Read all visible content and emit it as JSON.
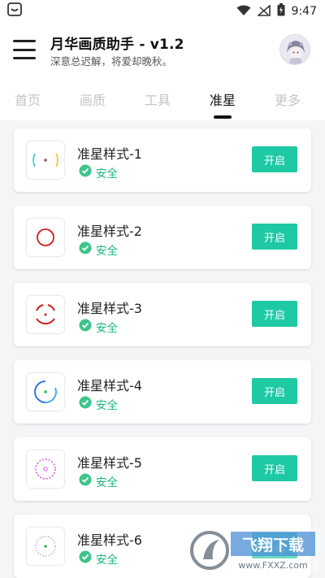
{
  "status_bar": {
    "time": "9:47",
    "icons": [
      "app-notification-icon",
      "wifi-icon",
      "signal-icon",
      "battery-icon"
    ]
  },
  "header": {
    "title": "月华画质助手 - v1.2",
    "subtitle": "深意总迟解，将爱却晚秋。",
    "menu_icon": "hamburger-menu-icon",
    "avatar_icon": "avatar"
  },
  "tabs": [
    {
      "label": "首页",
      "active": false
    },
    {
      "label": "画质",
      "active": false
    },
    {
      "label": "工具",
      "active": false
    },
    {
      "label": "准星",
      "active": true
    },
    {
      "label": "更多",
      "active": false
    }
  ],
  "crosshairs": [
    {
      "title": "准星样式-1",
      "status": "安全",
      "button": "开启",
      "icon": "crosshair-bracket-icon"
    },
    {
      "title": "准星样式-2",
      "status": "安全",
      "button": "开启",
      "icon": "crosshair-circle-icon"
    },
    {
      "title": "准星样式-3",
      "status": "安全",
      "button": "开启",
      "icon": "crosshair-arcs-icon"
    },
    {
      "title": "准星样式-4",
      "status": "安全",
      "button": "开启",
      "icon": "crosshair-dual-arc-icon"
    },
    {
      "title": "准星样式-5",
      "status": "安全",
      "button": "开启",
      "icon": "crosshair-dashed-ring-icon"
    },
    {
      "title": "准星样式-6",
      "status": "安全",
      "button": "开启",
      "icon": "crosshair-dotted-ring-icon"
    }
  ],
  "colors": {
    "accent": "#1ec9a4",
    "safe_green": "#19b77e",
    "list_background": "#f4f5f7"
  },
  "watermark": {
    "brand": "飞翔下载",
    "url": "www.FXXZ.com"
  }
}
